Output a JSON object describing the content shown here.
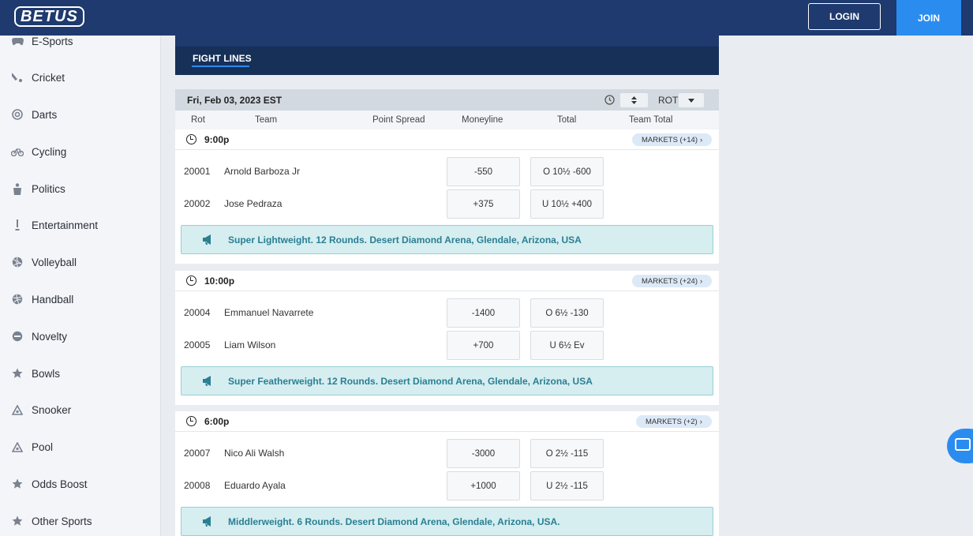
{
  "header": {
    "logo": "BETUS",
    "login_label": "LOGIN",
    "join_label": "JOIN"
  },
  "sidebar": {
    "items": [
      {
        "label": "E-Sports",
        "icon": "gamepad-icon"
      },
      {
        "label": "Cricket",
        "icon": "cricket-icon"
      },
      {
        "label": "Darts",
        "icon": "dartboard-icon"
      },
      {
        "label": "Cycling",
        "icon": "bicycle-icon"
      },
      {
        "label": "Politics",
        "icon": "podium-icon"
      },
      {
        "label": "Entertainment",
        "icon": "microphone-icon"
      },
      {
        "label": "Volleyball",
        "icon": "volleyball-icon"
      },
      {
        "label": "Handball",
        "icon": "handball-icon"
      },
      {
        "label": "Novelty",
        "icon": "new-badge-icon"
      },
      {
        "label": "Bowls",
        "icon": "star-icon"
      },
      {
        "label": "Snooker",
        "icon": "triangle-rack-icon"
      },
      {
        "label": "Pool",
        "icon": "triangle-rack-icon"
      },
      {
        "label": "Odds Boost",
        "icon": "star-icon"
      },
      {
        "label": "Other Sports",
        "icon": "star-icon"
      }
    ]
  },
  "main": {
    "tab_label": "FIGHT LINES",
    "date_label": "Fri, Feb 03, 2023 EST",
    "sort_label": "ROT",
    "columns": [
      "Rot",
      "Team",
      "Point Spread",
      "Moneyline",
      "Total",
      "Team Total"
    ],
    "events": [
      {
        "time": "9:00p",
        "markets": "MARKETS (+14)",
        "fighters": [
          {
            "rot": "20001",
            "name": "Arnold Barboza Jr",
            "moneyline": "-550",
            "total": "O 10½ -600"
          },
          {
            "rot": "20002",
            "name": "Jose Pedraza",
            "moneyline": "+375",
            "total": "U 10½ +400"
          }
        ],
        "info": "Super Lightweight. 12 Rounds. Desert Diamond Arena, Glendale, Arizona, USA"
      },
      {
        "time": "10:00p",
        "markets": "MARKETS (+24)",
        "fighters": [
          {
            "rot": "20004",
            "name": "Emmanuel Navarrete",
            "moneyline": "-1400",
            "total": "O 6½ -130"
          },
          {
            "rot": "20005",
            "name": "Liam Wilson",
            "moneyline": "+700",
            "total": "U 6½ Ev"
          }
        ],
        "info": "Super Featherweight. 12 Rounds. Desert Diamond Arena, Glendale, Arizona, USA"
      },
      {
        "time": "6:00p",
        "markets": "MARKETS (+2)",
        "fighters": [
          {
            "rot": "20007",
            "name": "Nico Ali Walsh",
            "moneyline": "-3000",
            "total": "O 2½ -115"
          },
          {
            "rot": "20008",
            "name": "Eduardo Ayala",
            "moneyline": "+1000",
            "total": "U 2½ -115"
          }
        ],
        "info": "Middlerweight. 6 Rounds. Desert Diamond Arena, Glendale, Arizona, USA."
      }
    ]
  },
  "colors": {
    "navy": "#1e3a6e",
    "accent_blue": "#2b8cf0",
    "info_text": "#2a7f93",
    "info_bg": "#d6eef0"
  }
}
